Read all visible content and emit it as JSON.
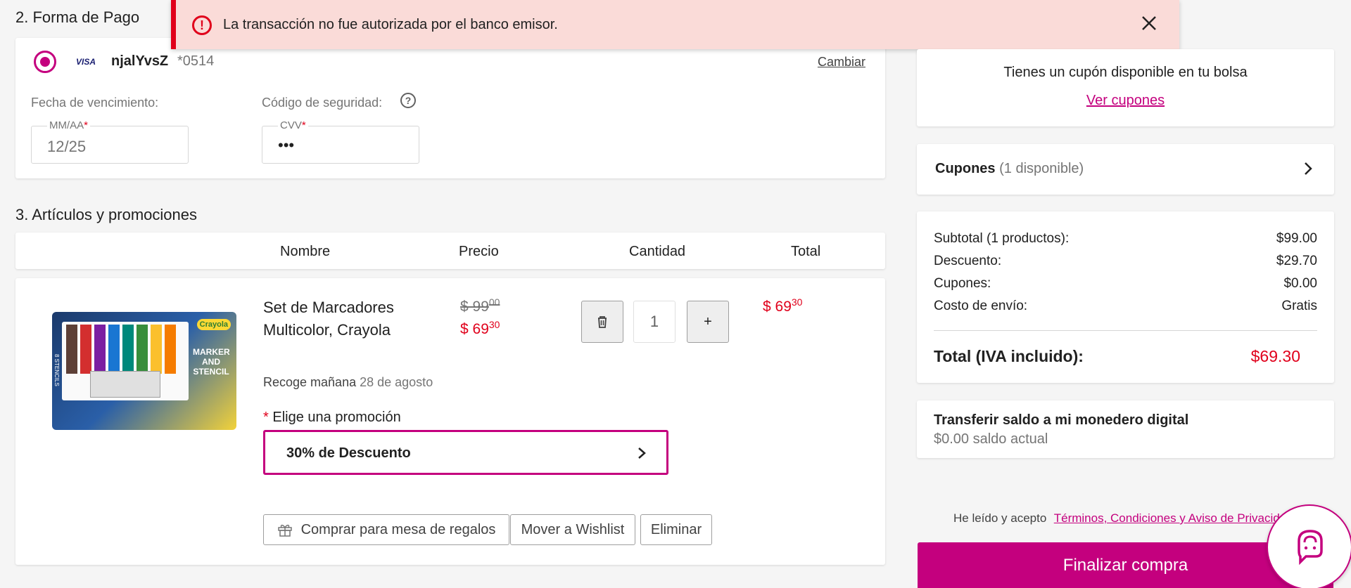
{
  "alert": {
    "message": "La transacción no fue autorizada por el banco emisor."
  },
  "payment": {
    "section_title": "2. Forma de Pago",
    "card_brand": "VISA",
    "card_holder": "njalYvsZ",
    "card_last4": "*0514",
    "change_label": "Cambiar",
    "expiry_label": "Fecha de vencimiento:",
    "expiry_field_label": "MM/AA",
    "expiry_value": "12/25",
    "cvv_label": "Código de seguridad:",
    "cvv_field_label": "CVV",
    "cvv_value": "•••",
    "required_mark": "*"
  },
  "items": {
    "section_title": "3. Artículos y promociones",
    "headers": {
      "name": "Nombre",
      "price": "Precio",
      "qty": "Cantidad",
      "total": "Total"
    },
    "product": {
      "name": "Set de Marcadores Multicolor, Crayola",
      "old_price": "$ 99",
      "old_cents": "00",
      "price": "$ 69",
      "price_cents": "30",
      "quantity": "1",
      "plus": "+",
      "total": "$ 69",
      "total_cents": "30",
      "pickup_prefix": "Recoge mañana",
      "pickup_date": "28 de agosto",
      "promo_label": "Elige una promoción",
      "promo_value": "30% de Descuento",
      "actions": [
        "Comprar para mesa de regalos",
        "Mover a Wishlist",
        "Eliminar"
      ],
      "box_text": {
        "brand": "Crayola",
        "title": "MARKER AND STENCIL",
        "side": "8 STENCILS"
      }
    }
  },
  "sidebar": {
    "coupon_banner": "Tienes un cupón disponible en tu bolsa",
    "see_coupons": "Ver cupones",
    "coupons_title": "Cupones",
    "coupons_count": "(1 disponible)",
    "summary": [
      {
        "label": "Subtotal (1 productos):",
        "value": "$99.00"
      },
      {
        "label": "Descuento:",
        "value": "$29.70"
      },
      {
        "label": "Cupones:",
        "value": "$0.00"
      },
      {
        "label": "Costo de envío:",
        "value": "Gratis"
      }
    ],
    "total_label": "Total (IVA incluido):",
    "total_value": "$69.30",
    "wallet_title": "Transferir saldo a mi monedero digital",
    "wallet_balance": "$0.00 saldo actual",
    "terms_prefix": "He leído y acepto",
    "terms_link": "Términos, Condiciones y Aviso de Privacidad",
    "checkout_button": "Finalizar compra"
  },
  "colors": {
    "brand": "#c4007e",
    "price_red": "#e0001b",
    "alert_bg": "#fadbd8",
    "alert_bar": "#e0001b"
  }
}
